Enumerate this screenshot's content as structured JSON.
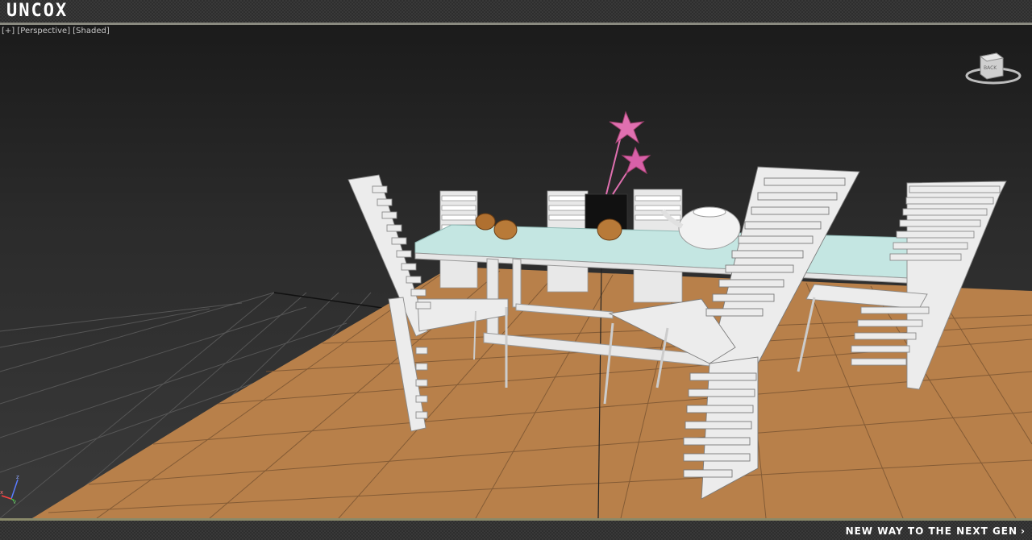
{
  "brand": {
    "logo_text": "UNCOX",
    "tagline": "NEW WAY TO THE NEXT GEN",
    "tagline_icon": "chevron-right-icon"
  },
  "viewport": {
    "label_plus": "[+]",
    "label_view": "[Perspective]",
    "label_mode": "[Shaded]",
    "viewcube_face": "BACK"
  },
  "axis": {
    "x": "x",
    "y": "y",
    "z": "z"
  },
  "colors": {
    "floor": "#b8804a",
    "grid": "#5a5a5a",
    "glass": "#bfe3e0",
    "chair": "#e6e6e6",
    "flower": "#e070b0",
    "mug": "#b07030"
  }
}
